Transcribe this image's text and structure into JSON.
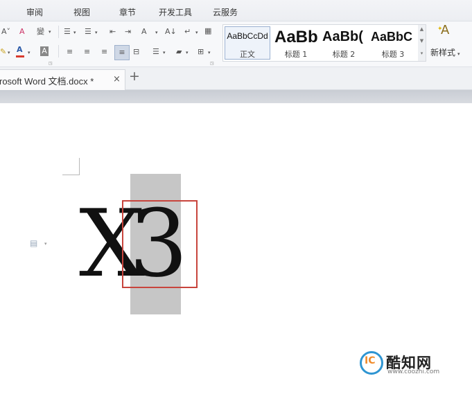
{
  "menu": {
    "items": [
      "审阅",
      "视图",
      "章节",
      "开发工具",
      "云服务"
    ]
  },
  "ribbon": {
    "font_shrink": "A˅",
    "clear_format": "A",
    "phonetic": "變",
    "font_color": "A",
    "char_shading": "A",
    "bullets": "☰",
    "numbering": "☰",
    "outdent": "⇤",
    "indent": "⇥",
    "text_direction": "A",
    "sort": "A↓",
    "show_marks": "↵",
    "table": "▦",
    "align_left": "≡",
    "align_center": "≡",
    "align_right": "≡",
    "justify": "≡",
    "distribute": "⊟",
    "line_spacing": "☰",
    "shading": "▰",
    "borders": "⊞",
    "styles": [
      {
        "sample": "AaBbCcDd",
        "name": "正文"
      },
      {
        "sample": "AaBb",
        "name": "标题 1"
      },
      {
        "sample": "AaBb(",
        "name": "标题 2"
      },
      {
        "sample": "AaBbC",
        "name": "标题 3"
      }
    ],
    "new_style_label": "新样式",
    "new_style_icon": "A"
  },
  "tabs": {
    "doc_title": "rosoft Word 文档.docx *",
    "close_symbol": "×",
    "new_tab_symbol": "+"
  },
  "document": {
    "char_x": "X",
    "char_3": "3"
  },
  "watermark": {
    "logo_letters": "IC",
    "name": "酷知网",
    "url": "www.coozhi.com"
  },
  "colors": {
    "highlight": "#c6c6c6",
    "red_box": "#c8443c",
    "font_color_bar": "#d83a2e",
    "watermark_blue": "#2f95d2"
  }
}
